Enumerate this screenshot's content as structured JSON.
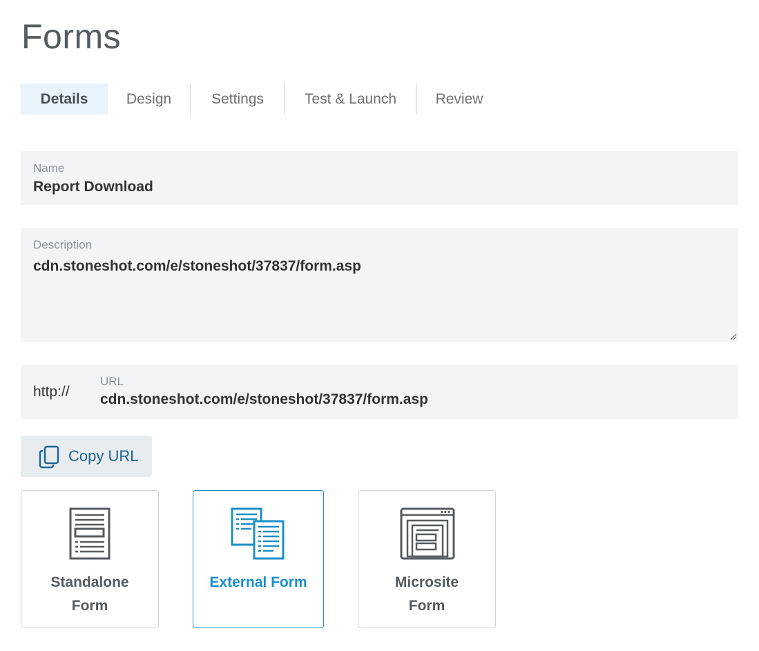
{
  "page": {
    "title": "Forms"
  },
  "tabs": [
    {
      "label": "Details",
      "active": true
    },
    {
      "label": "Design",
      "active": false
    },
    {
      "label": "Settings",
      "active": false
    },
    {
      "label": "Test & Launch",
      "active": false
    },
    {
      "label": "Review",
      "active": false
    }
  ],
  "name_field": {
    "label": "Name",
    "value": "Report Download"
  },
  "description_field": {
    "label": "Description",
    "value": "cdn.stoneshot.com/e/stoneshot/37837/form.asp"
  },
  "url_field": {
    "prefix": "http://",
    "label": "URL",
    "value": "cdn.stoneshot.com/e/stoneshot/37837/form.asp"
  },
  "copy_button": {
    "label": "Copy URL",
    "icon": "copy-icon"
  },
  "form_types": [
    {
      "label_line1": "Standalone",
      "label_line2": "Form",
      "icon": "standalone-form-icon",
      "selected": false
    },
    {
      "label_line1": "External Form",
      "label_line2": "",
      "icon": "external-form-icon",
      "selected": true
    },
    {
      "label_line1": "Microsite",
      "label_line2": "Form",
      "icon": "microsite-form-icon",
      "selected": false
    }
  ],
  "colors": {
    "accent": "#1a8fc9",
    "link": "#1a6496",
    "active_tab_bg": "#e8f3fb",
    "field_bg": "#f2f4f6",
    "icon_gray": "#555a5e"
  }
}
